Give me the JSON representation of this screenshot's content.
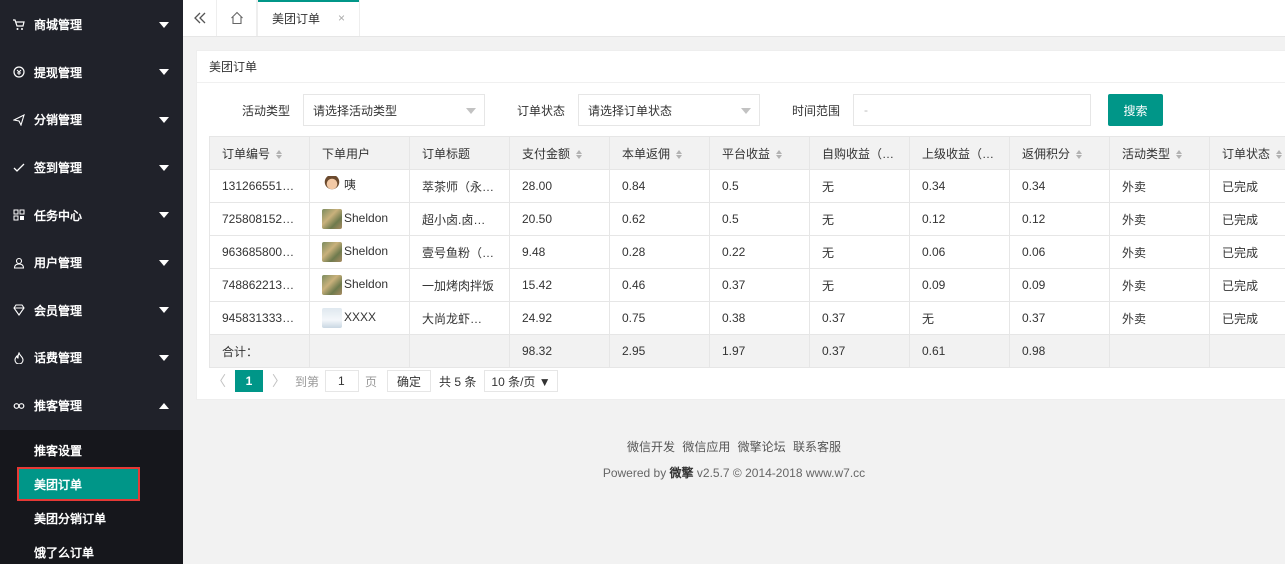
{
  "sidebar": {
    "items": [
      {
        "label": "商城管理",
        "icon": "cart-icon"
      },
      {
        "label": "提现管理",
        "icon": "coin-icon"
      },
      {
        "label": "分销管理",
        "icon": "paper-plane-icon"
      },
      {
        "label": "签到管理",
        "icon": "check-icon"
      },
      {
        "label": "任务中心",
        "icon": "grid-icon"
      },
      {
        "label": "用户管理",
        "icon": "user-icon"
      },
      {
        "label": "会员管理",
        "icon": "diamond-icon"
      },
      {
        "label": "话费管理",
        "icon": "flame-icon"
      },
      {
        "label": "推客管理",
        "icon": "link-icon"
      }
    ],
    "sub_items": [
      {
        "label": "推客设置"
      },
      {
        "label": "美团订单"
      },
      {
        "label": "美团分销订单"
      },
      {
        "label": "饿了么订单"
      }
    ]
  },
  "topbar": {
    "tab_label": "美团订单",
    "tab_close": "×"
  },
  "panel": {
    "title": "美团订单",
    "filters": {
      "activity_label": "活动类型",
      "activity_value": "请选择活动类型",
      "status_label": "订单状态",
      "status_value": "请选择订单状态",
      "time_label": "时间范围",
      "time_placeholder": "-",
      "search_button": "搜索"
    },
    "table": {
      "headers": [
        "订单编号",
        "下单用户",
        "订单标题",
        "支付金额",
        "本单返佣",
        "平台收益",
        "自购收益（…",
        "上级收益（…",
        "返佣积分",
        "活动类型",
        "订单状态"
      ],
      "rows": [
        {
          "order_no": "131266551…",
          "user": "咦",
          "title": "萃茶师（永…",
          "pay": "28.00",
          "commission": "0.84",
          "platform": "0.5",
          "self": "无",
          "parent": "0.34",
          "points": "0.34",
          "type": "外卖",
          "status": "已完成"
        },
        {
          "order_no": "725808152…",
          "user": "Sheldon",
          "title": "超小卤.卤…",
          "pay": "20.50",
          "commission": "0.62",
          "platform": "0.5",
          "self": "无",
          "parent": "0.12",
          "points": "0.12",
          "type": "外卖",
          "status": "已完成"
        },
        {
          "order_no": "963685800…",
          "user": "Sheldon",
          "title": "壹号鱼粉（…",
          "pay": "9.48",
          "commission": "0.28",
          "platform": "0.22",
          "self": "无",
          "parent": "0.06",
          "points": "0.06",
          "type": "外卖",
          "status": "已完成"
        },
        {
          "order_no": "748862213…",
          "user": "Sheldon",
          "title": "一加烤肉拌饭",
          "pay": "15.42",
          "commission": "0.46",
          "platform": "0.37",
          "self": "无",
          "parent": "0.09",
          "points": "0.09",
          "type": "外卖",
          "status": "已完成"
        },
        {
          "order_no": "945831333…",
          "user": "XXXX",
          "title": "大尚龙虾…",
          "pay": "24.92",
          "commission": "0.75",
          "platform": "0.38",
          "self": "0.37",
          "parent": "无",
          "points": "0.37",
          "type": "外卖",
          "status": "已完成"
        }
      ],
      "total": {
        "label": "合计：",
        "pay": "98.32",
        "commission": "2.95",
        "platform": "1.97",
        "self": "0.37",
        "parent": "0.61",
        "points": "0.98"
      }
    },
    "pager": {
      "prev": "〈",
      "current": "1",
      "next": "〉",
      "goto_label": "到第",
      "goto_value": "1",
      "page_unit": "页",
      "confirm": "确定",
      "count": "共 5 条",
      "page_size": "10 条/页 ▼"
    }
  },
  "footer": {
    "links": [
      "微信开发",
      "微信应用",
      "微擎论坛",
      "联系客服"
    ],
    "powered_prefix": "Powered by",
    "brand": "微擎",
    "powered_suffix": "v2.5.7 © 2014-2018 www.w7.cc"
  },
  "colors": {
    "accent": "#009688",
    "sidebar": "#20222a",
    "highlight": "#e53935"
  }
}
